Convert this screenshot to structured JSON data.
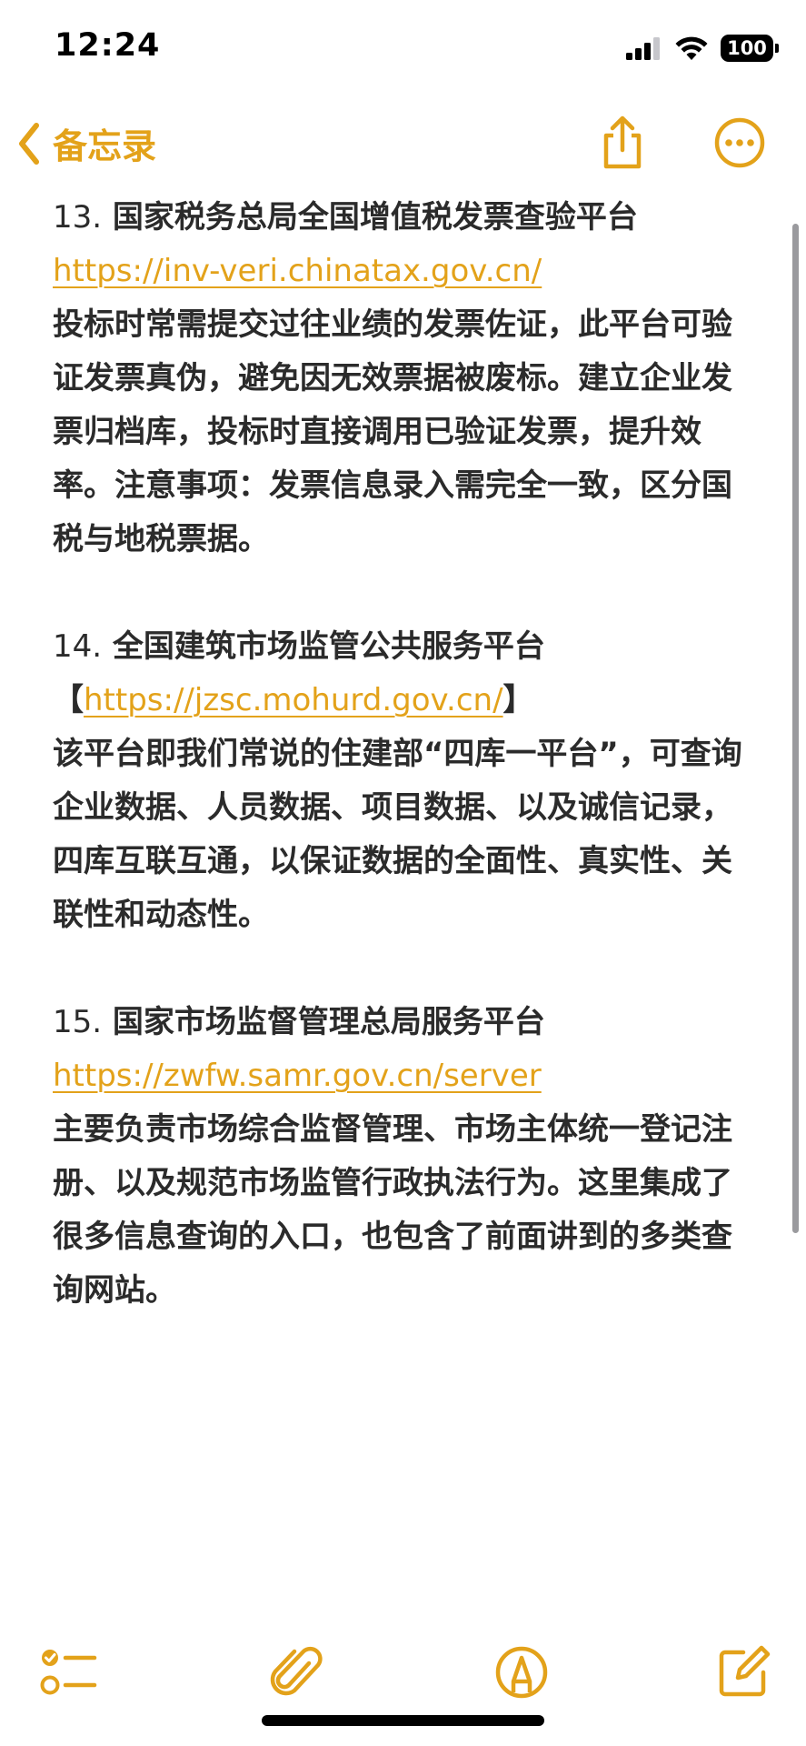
{
  "status_bar": {
    "time": "12:24",
    "battery": "100",
    "icons": [
      "cellular-signal-icon",
      "wifi-icon",
      "battery-icon"
    ]
  },
  "nav": {
    "back_label": "备忘录",
    "icons": [
      "chevron-left-icon",
      "share-icon",
      "more-icon"
    ]
  },
  "colors": {
    "accent": "#e3a21a",
    "text": "#2b2b2b"
  },
  "note": {
    "items": [
      {
        "number": "13.",
        "title": "国家税务总局全国增值税发票查验平台",
        "link": "https://inv-veri.chinatax.gov.cn/",
        "description": "投标时常需提交过往业绩的发票佐证，此平台可验证发票真伪，避免因无效票据被废标。建立企业发票归档库，投标时直接调用已验证发票，提升效率。注意事项：发票信息录入需完全一致，区分国税与地税票据。"
      },
      {
        "number": "14.",
        "title": "全国建筑市场监管公共服务平台【",
        "link": "https://jzsc.mohurd.gov.cn/",
        "title_suffix": "】",
        "description": "该平台即我们常说的住建部“四库一平台”，可查询企业数据、人员数据、项目数据、以及诚信记录，四库互联互通，以保证数据的全面性、真实性、关联性和动态性。"
      },
      {
        "number": "15.",
        "title": "国家市场监督管理总局服务平台",
        "link": "https://zwfw.samr.gov.cn/server",
        "description": "主要负责市场综合监督管理、市场主体统一登记注册、以及规范市场监管行政执法行为。这里集成了很多信息查询的入口，也包含了前面讲到的多类查询网站。"
      }
    ]
  },
  "toolbar": {
    "icons": [
      "checklist-icon",
      "paperclip-icon",
      "markup-pen-icon",
      "compose-icon"
    ]
  }
}
